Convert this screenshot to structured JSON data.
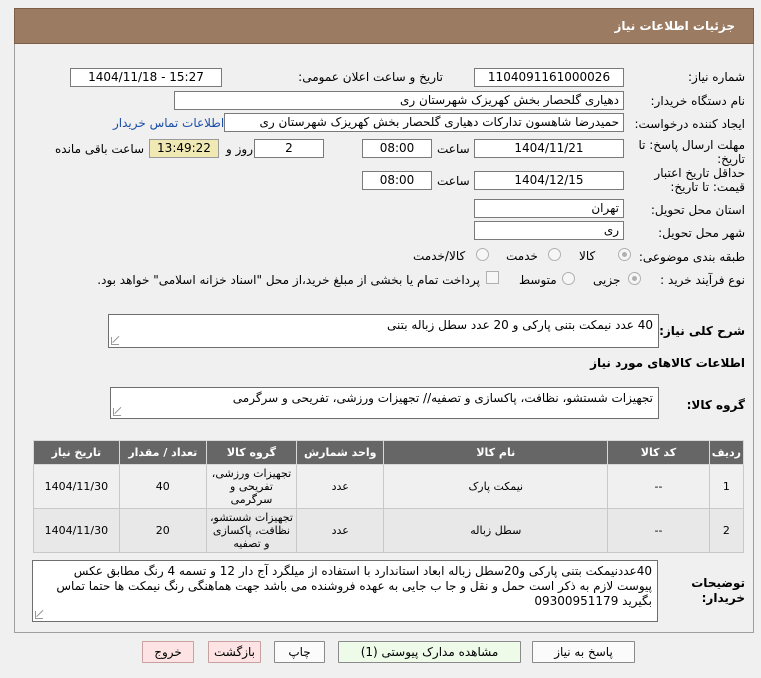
{
  "header": {
    "title": "جزئیات اطلاعات نیاز"
  },
  "form": {
    "need_number": {
      "label": "شماره نیاز:",
      "value": "1104091161000026"
    },
    "announce_datetime": {
      "label": "تاریخ و ساعت اعلان عمومی:",
      "value": "1404/11/18 - 15:27"
    },
    "buyer_org": {
      "label": "نام دستگاه خریدار:",
      "value": "دهیاری گلحصار بخش کهریزک شهرستان ری"
    },
    "requester": {
      "label": "ایجاد کننده درخواست:",
      "value": "حمیدرضا شاهسون تدارکات دهیاری گلحصار بخش کهریزک شهرستان ری",
      "contact_link": "اطلاعات تماس خریدار"
    },
    "deadline": {
      "label": "مهلت ارسال پاسخ: تا تاریخ:",
      "date": "1404/11/21",
      "time_label": "ساعت",
      "time": "08:00",
      "days": "2",
      "days_label": "روز و",
      "remaining": "13:49:22",
      "remaining_label": "ساعت باقی مانده"
    },
    "price_validity": {
      "label": "حداقل تاریخ اعتبار قیمت: تا تاریخ:",
      "date": "1404/12/15",
      "time_label": "ساعت",
      "time": "08:00"
    },
    "delivery_province": {
      "label": "استان محل تحویل:",
      "value": "تهران"
    },
    "delivery_city": {
      "label": "شهر محل تحویل:",
      "value": "ری"
    },
    "category": {
      "label": "طبقه بندی موضوعی:",
      "options": [
        "کالا",
        "خدمت",
        "کالا/خدمت"
      ],
      "selected": "کالا"
    },
    "process_type": {
      "label": "نوع فرآیند خرید :",
      "options": [
        "جزیی",
        "متوسط"
      ],
      "selected": "جزیی",
      "payment_note": "پرداخت تمام یا بخشی از مبلغ خرید،از محل \"اسناد خزانه اسلامی\" خواهد بود."
    }
  },
  "summary": {
    "label": "شرح کلی نیاز:",
    "value": "40 عدد نیمکت بتنی پارکی و 20 عدد سطل زباله بتنی"
  },
  "goods_section": {
    "title": "اطلاعات کالاهای مورد نیاز",
    "group_label": "گروه کالا:",
    "group_value": "تجهیزات شستشو، نظافت، پاکسازی و تصفیه// تجهیزات ورزشی، تفریحی و سرگرمی"
  },
  "table": {
    "headers": [
      "ردیف",
      "کد کالا",
      "نام کالا",
      "واحد شمارش",
      "گروه کالا",
      "تعداد / مقدار",
      "تاریخ نیاز"
    ],
    "rows": [
      {
        "row": "1",
        "code": "--",
        "name": "نیمکت پارک",
        "unit": "عدد",
        "group": "تجهیزات ورزشی، تفریحی و سرگرمی",
        "qty": "40",
        "date": "1404/11/30"
      },
      {
        "row": "2",
        "code": "--",
        "name": "سطل زباله",
        "unit": "عدد",
        "group": "تجهیزات شستشو، نظافت، پاکسازی و تصفیه",
        "qty": "20",
        "date": "1404/11/30"
      }
    ]
  },
  "buyer_notes": {
    "label": "توضیحات خریدار:",
    "value": "40عددنیمکت بتنی پارکی و20سطل زباله ابعاد استاندارد با استفاده از میلگرد آج دار 12 و تسمه 4 رنگ مطابق عکس پیوست لازم به ذکر است حمل و نقل و جا ب جایی به عهده فروشنده می باشد جهت هماهنگی رنگ نیمکت ها حتما تماس بگیرید 09300951179"
  },
  "buttons": {
    "reply": "پاسخ به نیاز",
    "view_docs": "مشاهده مدارک پیوستی (1)",
    "print": "چاپ",
    "back": "بازگشت",
    "exit": "خروج"
  }
}
